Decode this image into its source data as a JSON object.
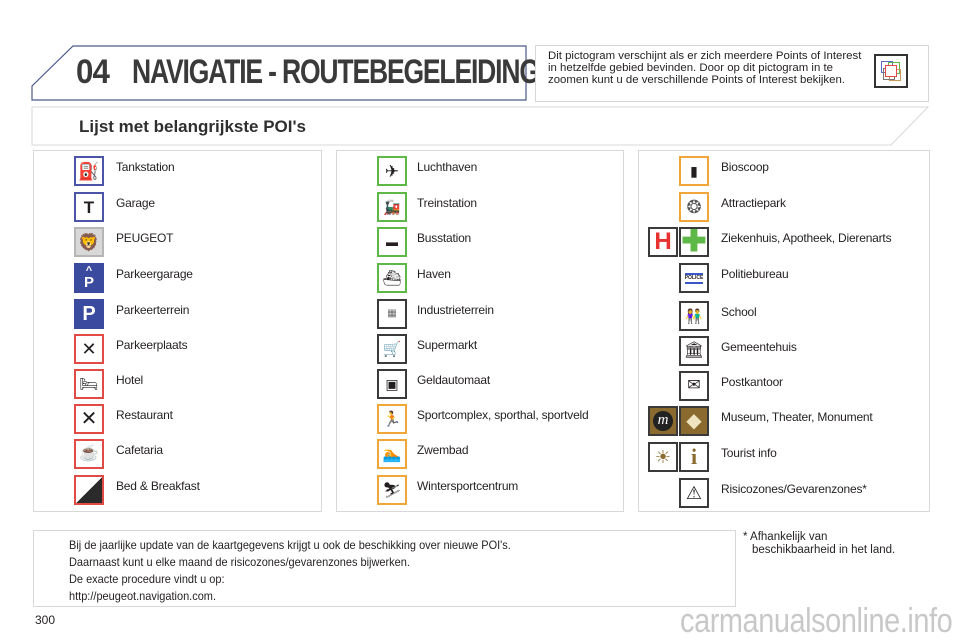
{
  "header": {
    "chapter_number": "04",
    "chapter_title": "NAVIGATIE - ROUTEBEGELEIDING"
  },
  "info_box": {
    "text": "Dit pictogram verschijnt als er zich meerdere Points of Interest in hetzelfde gebied bevinden. Door op dit pictogram in te zoomen kunt u de verschillende Points of Interest bekijken.",
    "icon": "multiple-poi-cluster-icon"
  },
  "section": {
    "title": "Lijst met belangrijkste POI's"
  },
  "columns": [
    {
      "items": [
        {
          "label": "Tankstation",
          "icons": [
            "fuel-pump-icon"
          ]
        },
        {
          "label": "Garage",
          "icons": [
            "wrench-icon"
          ]
        },
        {
          "label": "PEUGEOT",
          "icons": [
            "peugeot-lion-icon"
          ]
        },
        {
          "label": "Parkeergarage",
          "icons": [
            "covered-parking-icon"
          ]
        },
        {
          "label": "Parkeerterrein",
          "icons": [
            "parking-icon"
          ]
        },
        {
          "label": "Parkeerplaats",
          "icons": [
            "rest-area-icon"
          ]
        },
        {
          "label": "Hotel",
          "icons": [
            "bed-icon"
          ]
        },
        {
          "label": "Restaurant",
          "icons": [
            "fork-knife-icon"
          ]
        },
        {
          "label": "Cafetaria",
          "icons": [
            "coffee-cup-icon"
          ]
        },
        {
          "label": "Bed & Breakfast",
          "icons": [
            "bed-breakfast-icon"
          ]
        }
      ]
    },
    {
      "items": [
        {
          "label": "Luchthaven",
          "icons": [
            "airplane-icon"
          ]
        },
        {
          "label": "Treinstation",
          "icons": [
            "train-icon"
          ]
        },
        {
          "label": "Busstation",
          "icons": [
            "bus-icon"
          ]
        },
        {
          "label": "Haven",
          "icons": [
            "harbour-ship-icon"
          ]
        },
        {
          "label": "Industrieterrein",
          "icons": [
            "industrial-zone-icon"
          ]
        },
        {
          "label": "Supermarkt",
          "icons": [
            "shopping-cart-icon"
          ]
        },
        {
          "label": "Geldautomaat",
          "icons": [
            "atm-icon"
          ]
        },
        {
          "label": "Sportcomplex, sporthal, sportveld",
          "icons": [
            "sport-icon"
          ]
        },
        {
          "label": "Zwembad",
          "icons": [
            "swimmer-icon"
          ]
        },
        {
          "label": "Wintersportcentrum",
          "icons": [
            "skier-icon"
          ]
        }
      ]
    },
    {
      "items": [
        {
          "label": "Bioscoop",
          "icons": [
            "film-icon"
          ]
        },
        {
          "label": "Attractiepark",
          "icons": [
            "ferris-wheel-icon"
          ]
        },
        {
          "label": "Ziekenhuis, Apotheek, Dierenarts",
          "icons": [
            "hospital-h-icon",
            "pharmacy-cross-icon"
          ]
        },
        {
          "label": "Politiebureau",
          "icons": [
            "police-icon"
          ]
        },
        {
          "label": "School",
          "icons": [
            "children-icon"
          ]
        },
        {
          "label": "Gemeentehuis",
          "icons": [
            "town-hall-icon"
          ]
        },
        {
          "label": "Postkantoor",
          "icons": [
            "envelope-icon"
          ]
        },
        {
          "label": "Museum, Theater, Monument",
          "icons": [
            "museum-m-icon",
            "monument-icon"
          ]
        },
        {
          "label": "Tourist info",
          "icons": [
            "sun-rays-icon",
            "info-icon"
          ]
        },
        {
          "label": "Risicozones/Gevarenzones*",
          "icons": [
            "warning-camera-icon"
          ]
        }
      ]
    }
  ],
  "footer": {
    "lines": [
      "Bij de jaarlijke update van de kaartgegevens krijgt u ook de beschikking over nieuwe POI's.",
      "Daarnaast kunt u elke maand de risicozones/gevarenzones bijwerken.",
      "De exacte procedure vindt u op:",
      "http://peugeot.navigation.com."
    ],
    "footnote_line1": "* Afhankelijk van",
    "footnote_line2": "beschikbaarheid in het land."
  },
  "page_number": "300",
  "watermark": "carmanualsonline.info",
  "colors": {
    "blue": "#4a55a8",
    "red": "#e24b45",
    "green": "#5db848",
    "orange": "#f0a638",
    "brown": "#8a6a2e",
    "border_gray": "#d8d8d8"
  }
}
